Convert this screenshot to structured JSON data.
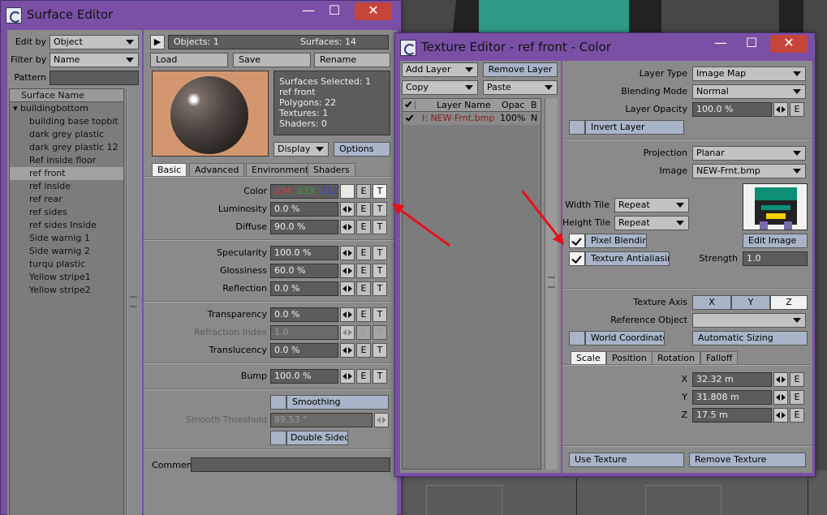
{
  "surface_editor": {
    "title": "Surface Editor",
    "edit_by": {
      "label": "Edit by",
      "value": "Object"
    },
    "filter_by": {
      "label": "Filter by",
      "value": "Name"
    },
    "pattern": {
      "label": "Pattern",
      "value": ""
    },
    "list_header": "Surface Name",
    "group": "buildingbottom",
    "surfaces": [
      "building base topbit",
      "dark grey plastic",
      "dark grey plastic 12",
      "Ref inside floor",
      "ref front",
      "ref inside",
      "ref rear",
      "ref sides",
      "ref sides Inside",
      "Side warnig 1",
      "Side warnig 2",
      "turqu plastic",
      "Yellow stripe1",
      "Yellow stripe2"
    ],
    "selected_surface": "ref front",
    "objects": "Objects: 1",
    "surfaces_count": "Surfaces: 14",
    "load": "Load",
    "save": "Save",
    "rename": "Rename",
    "info": [
      "Surfaces Selected: 1",
      "ref front",
      "Polygons: 22",
      "Textures: 1",
      "Shaders: 0"
    ],
    "display": "Display",
    "options": "Options",
    "tabs": [
      "Basic",
      "Advanced",
      "Environment",
      "Shaders"
    ],
    "color": {
      "label": "Color",
      "r": "234",
      "g": "233",
      "b": "232"
    },
    "luminosity": {
      "label": "Luminosity",
      "value": "0.0 %"
    },
    "diffuse": {
      "label": "Diffuse",
      "value": "90.0 %"
    },
    "specularity": {
      "label": "Specularity",
      "value": "100.0 %"
    },
    "glossiness": {
      "label": "Glossiness",
      "value": "60.0 %"
    },
    "reflection": {
      "label": "Reflection",
      "value": "0.0 %"
    },
    "transparency": {
      "label": "Transparency",
      "value": "0.0 %"
    },
    "refraction_index": {
      "label": "Refraction Index",
      "value": "1.0"
    },
    "translucency": {
      "label": "Translucency",
      "value": "0.0 %"
    },
    "bump": {
      "label": "Bump",
      "value": "100.0 %"
    },
    "smoothing": "Smoothing",
    "smooth_threshold": {
      "label": "Smooth Threshold",
      "value": "89.53 °"
    },
    "double_sided": "Double Sided",
    "comment": {
      "label": "Comment",
      "value": ""
    },
    "env_btn": "E",
    "tex_btn": "T"
  },
  "texture_editor": {
    "title": "Texture Editor - ref front - Color",
    "add_layer": "Add Layer",
    "remove_layer": "Remove Layer",
    "copy": "Copy",
    "paste": "Paste",
    "cols": {
      "name": "Layer Name",
      "opac": "Opac",
      "b": "B"
    },
    "layer": {
      "name": "I: NEW-Frnt.bmp",
      "opac": "100%",
      "b": "N"
    },
    "layer_type": {
      "label": "Layer Type",
      "value": "Image Map"
    },
    "blending_mode": {
      "label": "Blending Mode",
      "value": "Normal"
    },
    "layer_opacity": {
      "label": "Layer Opacity",
      "value": "100.0 %"
    },
    "invert_layer": "Invert Layer",
    "projection": {
      "label": "Projection",
      "value": "Planar"
    },
    "image": {
      "label": "Image",
      "value": "NEW-Frnt.bmp"
    },
    "width_tile": {
      "label": "Width Tile",
      "value": "Repeat"
    },
    "height_tile": {
      "label": "Height Tile",
      "value": "Repeat"
    },
    "pixel_blending": "Pixel Blending",
    "texture_antialiasing": "Texture Antialiasing",
    "edit_image": "Edit Image",
    "strength": {
      "label": "Strength",
      "value": "1.0"
    },
    "texture_axis": {
      "label": "Texture Axis",
      "x": "X",
      "y": "Y",
      "z": "Z"
    },
    "reference_object": {
      "label": "Reference Object",
      "value": ""
    },
    "world_coordinates": "World Coordinates",
    "automatic_sizing": "Automatic Sizing",
    "tabs": [
      "Scale",
      "Position",
      "Rotation",
      "Falloff"
    ],
    "scale_x": {
      "label": "X",
      "value": "32.32 m"
    },
    "scale_y": {
      "label": "Y",
      "value": "31.808 m"
    },
    "scale_z": {
      "label": "Z",
      "value": "17.5 m"
    },
    "use_texture": "Use Texture",
    "remove_texture": "Remove Texture",
    "env_btn": "E"
  },
  "colors": {
    "accent": "#7a50a6",
    "arrow": "#e3121a",
    "r": "#e23a3a",
    "g": "#3aa13a",
    "b": "#3a3ad8"
  }
}
